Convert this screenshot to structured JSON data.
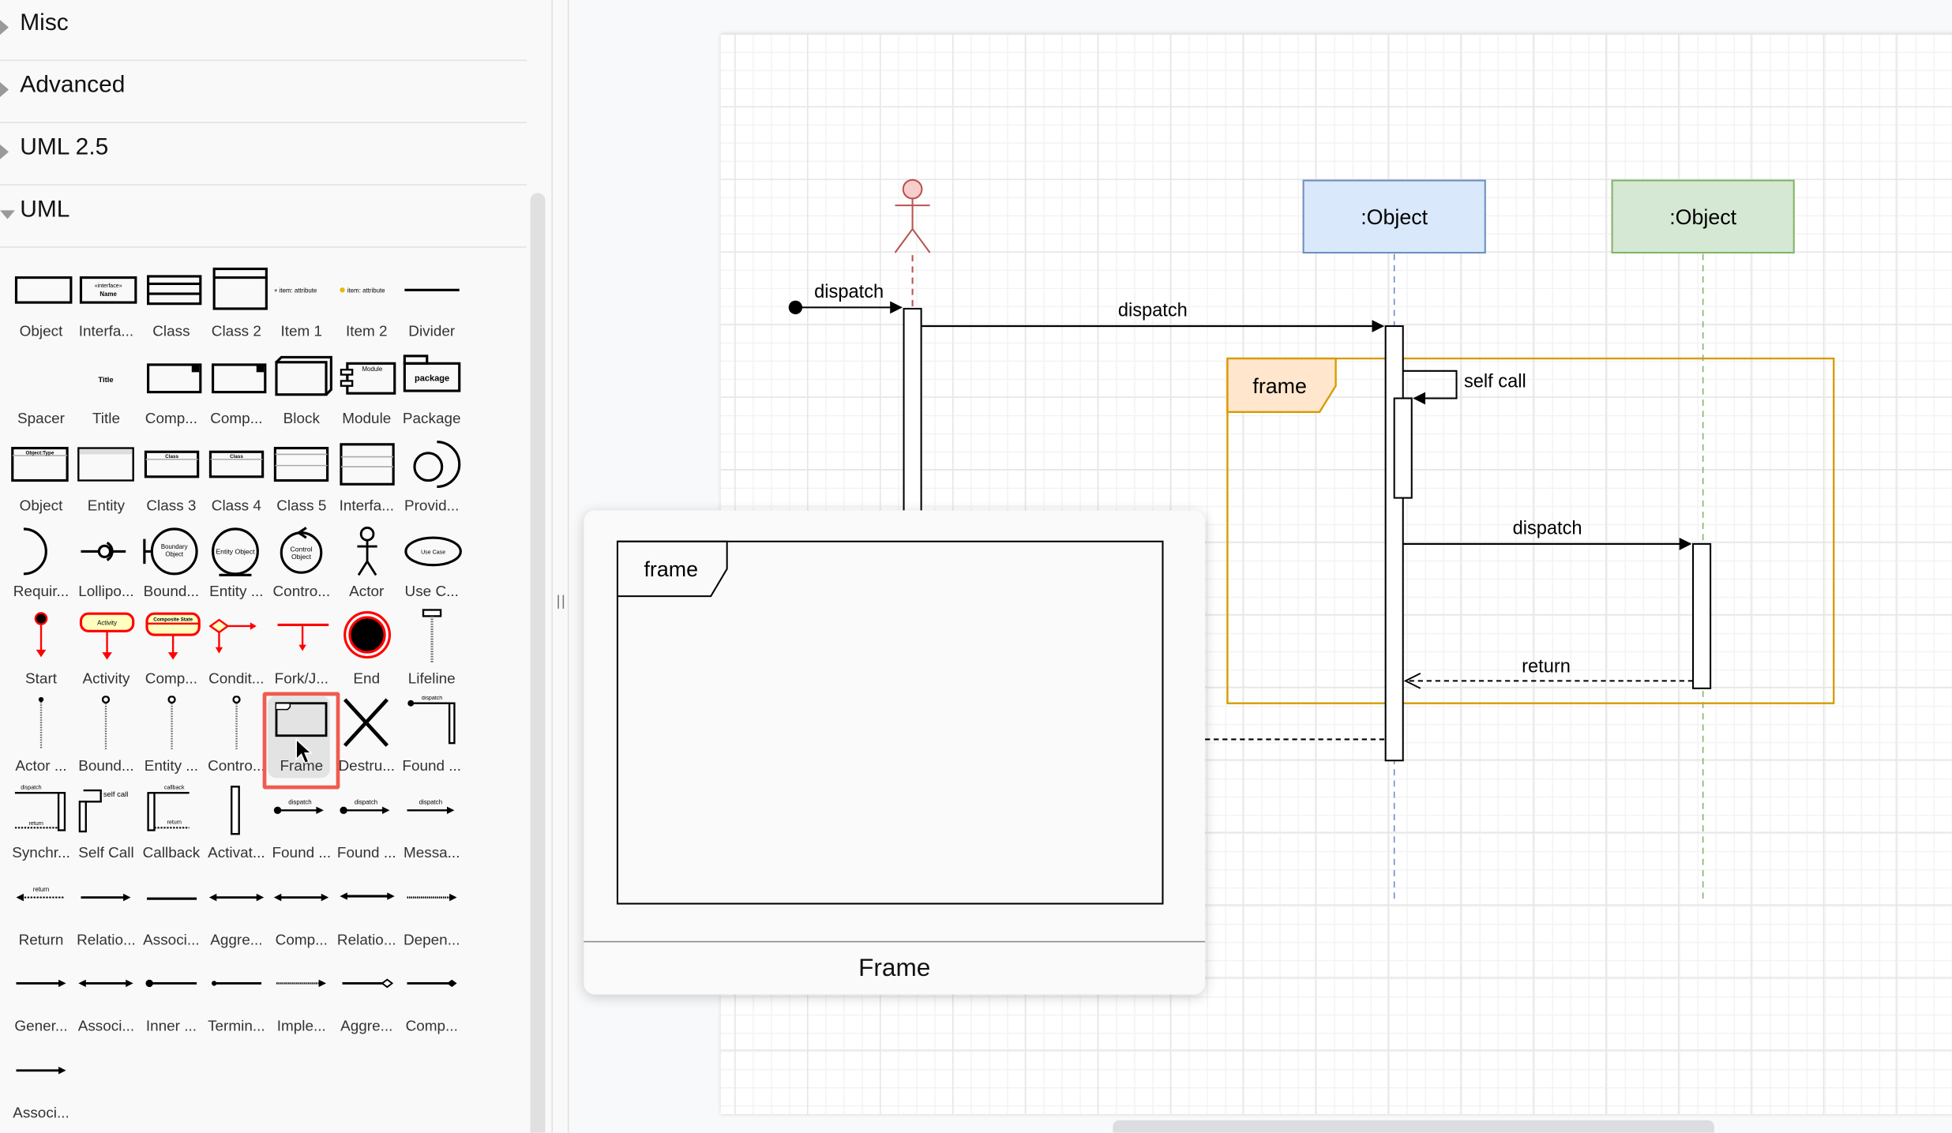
{
  "sidebar": {
    "sections": [
      {
        "label": "Misc",
        "expanded": false
      },
      {
        "label": "Advanced",
        "expanded": false
      },
      {
        "label": "UML 2.5",
        "expanded": false
      },
      {
        "label": "UML",
        "expanded": true
      }
    ],
    "shapes": [
      {
        "label": "Object",
        "icon": "object-shape"
      },
      {
        "label": "Interfa...",
        "icon": "interface-shape"
      },
      {
        "label": "Class",
        "icon": "class-shape"
      },
      {
        "label": "Class 2",
        "icon": "class2-shape"
      },
      {
        "label": "Item 1",
        "icon": "item1-shape",
        "text": "+ item: attribute"
      },
      {
        "label": "Item 2",
        "icon": "item2-shape",
        "text": "item: attribute"
      },
      {
        "label": "Divider",
        "icon": "divider-shape"
      },
      {
        "label": "Spacer",
        "icon": "spacer-shape"
      },
      {
        "label": "Title",
        "icon": "title-shape",
        "text": "Title"
      },
      {
        "label": "Comp...",
        "icon": "component-shape"
      },
      {
        "label": "Comp...",
        "icon": "component2-shape"
      },
      {
        "label": "Block",
        "icon": "block-shape"
      },
      {
        "label": "Module",
        "icon": "module-shape",
        "text": "Module"
      },
      {
        "label": "Package",
        "icon": "package-shape",
        "text": "package"
      },
      {
        "label": "Object",
        "icon": "object-type-shape"
      },
      {
        "label": "Entity",
        "icon": "entity-table-shape"
      },
      {
        "label": "Class 3",
        "icon": "class3-shape"
      },
      {
        "label": "Class 4",
        "icon": "class4-shape"
      },
      {
        "label": "Class 5",
        "icon": "class5-shape"
      },
      {
        "label": "Interfa...",
        "icon": "interface2-shape"
      },
      {
        "label": "Provid...",
        "icon": "provided-interface-shape"
      },
      {
        "label": "Requir...",
        "icon": "required-interface-shape"
      },
      {
        "label": "Lollipo...",
        "icon": "lollipop-shape"
      },
      {
        "label": "Bound...",
        "icon": "boundary-object-shape",
        "text": "Boundary Object"
      },
      {
        "label": "Entity ...",
        "icon": "entity-object-shape",
        "text": "Entity Object"
      },
      {
        "label": "Contro...",
        "icon": "control-object-shape",
        "text": "Control Object"
      },
      {
        "label": "Actor",
        "icon": "actor-shape"
      },
      {
        "label": "Use C...",
        "icon": "use-case-shape",
        "text": "Use Case"
      },
      {
        "label": "Start",
        "icon": "start-shape"
      },
      {
        "label": "Activity",
        "icon": "activity-shape",
        "text": "Activity"
      },
      {
        "label": "Comp...",
        "icon": "composite-state-shape",
        "text": "Composite State"
      },
      {
        "label": "Condit...",
        "icon": "condition-shape"
      },
      {
        "label": "Fork/J...",
        "icon": "fork-join-shape"
      },
      {
        "label": "End",
        "icon": "end-shape"
      },
      {
        "label": "Lifeline",
        "icon": "lifeline-shape"
      },
      {
        "label": "Actor ...",
        "icon": "actor-lifeline-shape"
      },
      {
        "label": "Bound...",
        "icon": "boundary-lifeline-shape"
      },
      {
        "label": "Entity ...",
        "icon": "entity-lifeline-shape"
      },
      {
        "label": "Contro...",
        "icon": "control-lifeline-shape"
      },
      {
        "label": "Frame",
        "icon": "frame-shape",
        "selected": true
      },
      {
        "label": "Destru...",
        "icon": "destruction-shape"
      },
      {
        "label": "Found ...",
        "icon": "found-message-activation-shape",
        "text": "dispatch"
      },
      {
        "label": "Synchr...",
        "icon": "synchronous-call-shape",
        "text": "dispatch"
      },
      {
        "label": "Self Call",
        "icon": "self-call-shape",
        "text": "self call"
      },
      {
        "label": "Callback",
        "icon": "callback-shape",
        "text": "callback"
      },
      {
        "label": "Activat...",
        "icon": "activation-shape"
      },
      {
        "label": "Found ...",
        "icon": "found-message-shape",
        "text": "dispatch"
      },
      {
        "label": "Found ...",
        "icon": "found-message2-shape",
        "text": "dispatch"
      },
      {
        "label": "Messa...",
        "icon": "message-shape",
        "text": "dispatch"
      },
      {
        "label": "Return",
        "icon": "return-shape",
        "text": "return"
      },
      {
        "label": "Relatio...",
        "icon": "relation-shape"
      },
      {
        "label": "Associ...",
        "icon": "association-shape"
      },
      {
        "label": "Aggre...",
        "icon": "aggregation-shape"
      },
      {
        "label": "Comp...",
        "icon": "composition-shape"
      },
      {
        "label": "Relatio...",
        "icon": "relation2-shape"
      },
      {
        "label": "Depen...",
        "icon": "dependency-shape"
      },
      {
        "label": "Gener...",
        "icon": "generalization-shape"
      },
      {
        "label": "Associ...",
        "icon": "association2-shape"
      },
      {
        "label": "Inner ...",
        "icon": "inner-class-shape"
      },
      {
        "label": "Termin...",
        "icon": "terminator-shape"
      },
      {
        "label": "Imple...",
        "icon": "implementation-shape"
      },
      {
        "label": "Aggre...",
        "icon": "aggregation2-shape"
      },
      {
        "label": "Comp...",
        "icon": "composition2-shape"
      },
      {
        "label": "Associ...",
        "icon": "association3-shape"
      }
    ]
  },
  "diagram": {
    "actor_color": "#b85450",
    "actor_fill": "#f8cecc",
    "lifelines": [
      {
        "label": ":Object",
        "fill": "#dae8fc",
        "stroke": "#6c8ebf"
      },
      {
        "label": ":Object",
        "fill": "#d5e8d4",
        "stroke": "#82b366"
      }
    ],
    "messages": [
      {
        "label": "dispatch",
        "kind": "found"
      },
      {
        "label": "dispatch",
        "kind": "sync"
      },
      {
        "label": "self call",
        "kind": "self"
      },
      {
        "label": "dispatch",
        "kind": "sync"
      },
      {
        "label": "return",
        "kind": "return"
      }
    ],
    "frame": {
      "label": "frame",
      "stroke": "#d79b00",
      "fill": "#ffe6cc"
    }
  },
  "tooltip": {
    "title": "Frame",
    "preview_label": "frame"
  }
}
